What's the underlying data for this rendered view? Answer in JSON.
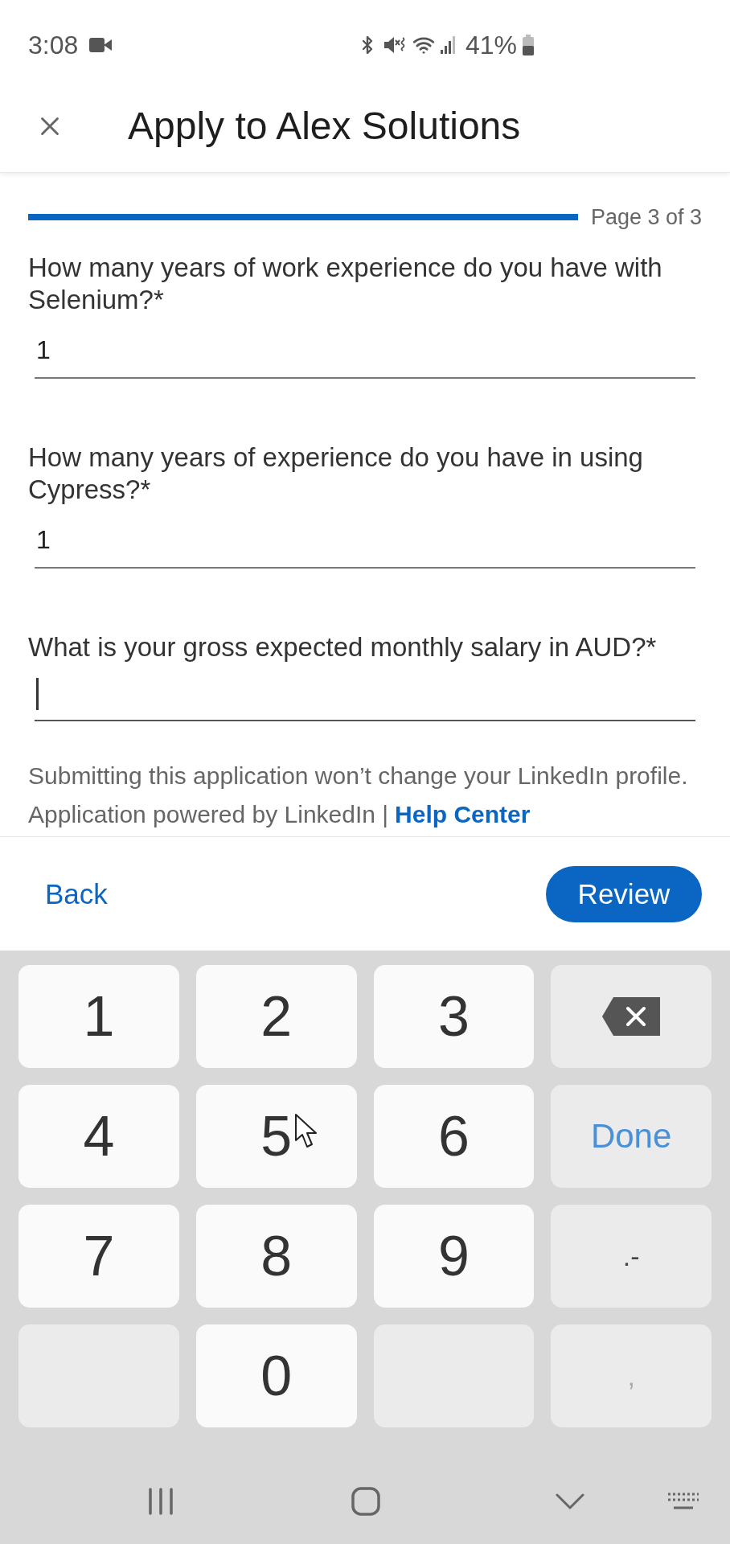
{
  "status_bar": {
    "time": "3:08",
    "battery_text": "41%"
  },
  "header": {
    "title": "Apply to Alex Solutions"
  },
  "progress": {
    "level": 1,
    "label": "Page 3 of 3"
  },
  "questions": [
    {
      "label": "How many years of work experience do you have with Selenium?*",
      "value": "1",
      "focused": false
    },
    {
      "label": "How many years of experience do you have in using Cypress?*",
      "value": "1",
      "focused": false
    },
    {
      "label": "What is your gross expected monthly salary in AUD?*",
      "focused": true
    }
  ],
  "footer": {
    "notice": "Submitting this application won’t change your LinkedIn profile.",
    "powered_by": "Application powered by LinkedIn |",
    "help_link": "Help Center"
  },
  "actions": {
    "back": "Back",
    "review": "Review"
  },
  "keyboard": {
    "keys": [
      {
        "kind": "char",
        "label": "1"
      },
      {
        "kind": "char",
        "label": "2"
      },
      {
        "kind": "char",
        "label": "3"
      },
      {
        "kind": "backspace"
      },
      {
        "kind": "char",
        "label": "4"
      },
      {
        "kind": "char",
        "label": "5"
      },
      {
        "kind": "char",
        "label": "6"
      },
      {
        "kind": "action",
        "label": "Done"
      },
      {
        "kind": "char",
        "label": "7"
      },
      {
        "kind": "char",
        "label": "8"
      },
      {
        "kind": "char",
        "label": "9"
      },
      {
        "kind": "symbol",
        "label": ".-"
      },
      {
        "kind": "blank"
      },
      {
        "kind": "char",
        "label": "0"
      },
      {
        "kind": "blank"
      },
      {
        "kind": "dim",
        "label": ","
      }
    ]
  }
}
